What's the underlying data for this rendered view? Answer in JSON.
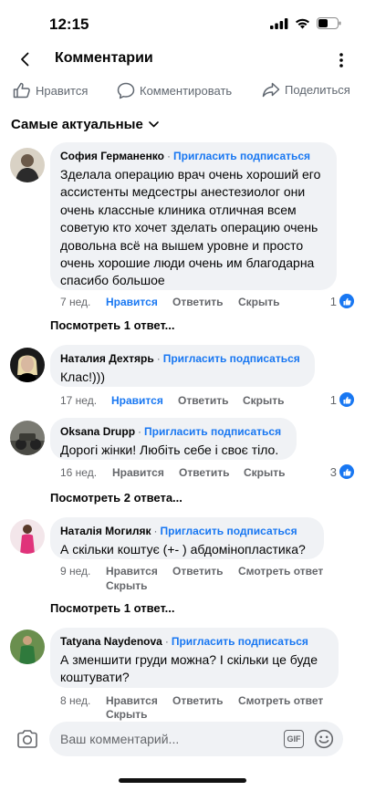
{
  "status_bar": {
    "time": "12:15",
    "icons": [
      "signal-icon",
      "wifi-icon",
      "battery-icon"
    ]
  },
  "header": {
    "title": "Комментарии",
    "back_icon": "chevron-left-icon",
    "more_icon": "more-vertical-icon"
  },
  "post_actions": {
    "like": "Нравится",
    "comment": "Комментировать",
    "share": "Поделиться"
  },
  "sort": {
    "label": "Самые актуальные"
  },
  "comments": [
    {
      "name": "София Германенко",
      "invite": "Пригласить подписаться",
      "text": "Зделала операцию врач очень хороший его ассистенты медсестры анестезиолог они очень классные клиника отличная всем советую кто хочет зделать операцию очень довольна всё на вышем уровне и просто очень хорошие люди очень им благодарна спасибо большое",
      "time": "7 нед.",
      "like": "Нравится",
      "reply": "Ответить",
      "hide": "Скрыть",
      "liked": true,
      "reactions": "1",
      "view_replies": "Посмотреть 1 ответ..."
    },
    {
      "name": "Наталия Дехтярь",
      "invite": "Пригласить подписаться",
      "text": "Клас!)))",
      "time": "17 нед.",
      "like": "Нравится",
      "reply": "Ответить",
      "hide": "Скрыть",
      "liked": true,
      "reactions": "1"
    },
    {
      "name": "Oksana Drupp",
      "invite": "Пригласить подписаться",
      "text": "Дорогі жінки! Любіть себе і своє тіло.",
      "time": "16 нед.",
      "like": "Нравится",
      "reply": "Ответить",
      "hide": "Скрыть",
      "liked": false,
      "reactions": "3",
      "view_replies": "Посмотреть 2 ответа..."
    },
    {
      "name": "Наталія Могиляк",
      "invite": "Пригласить подписаться",
      "text": "А скільки коштує (+- ) абдомінопластика?",
      "time": "9 нед.",
      "like": "Нравится",
      "reply": "Ответить",
      "see_reply": "Смотреть ответ",
      "hide": "Скрыть",
      "liked": false,
      "view_replies": "Посмотреть 1 ответ..."
    },
    {
      "name": "Tatyana Naydenova",
      "invite": "Пригласить подписаться",
      "text": "А зменшити груди можна? І скільки це буде коштувати?",
      "time": "8 нед.",
      "like": "Нравится",
      "reply": "Ответить",
      "see_reply": "Смотреть ответ",
      "hide": "Скрыть",
      "liked": false
    }
  ],
  "composer": {
    "placeholder": "Ваш комментарий...",
    "gif": "GIF",
    "camera_icon": "camera-icon",
    "emoji_icon": "emoji-icon"
  },
  "colors": {
    "accent": "#1877f2",
    "bubble": "#f0f2f5",
    "meta": "#65676b"
  }
}
